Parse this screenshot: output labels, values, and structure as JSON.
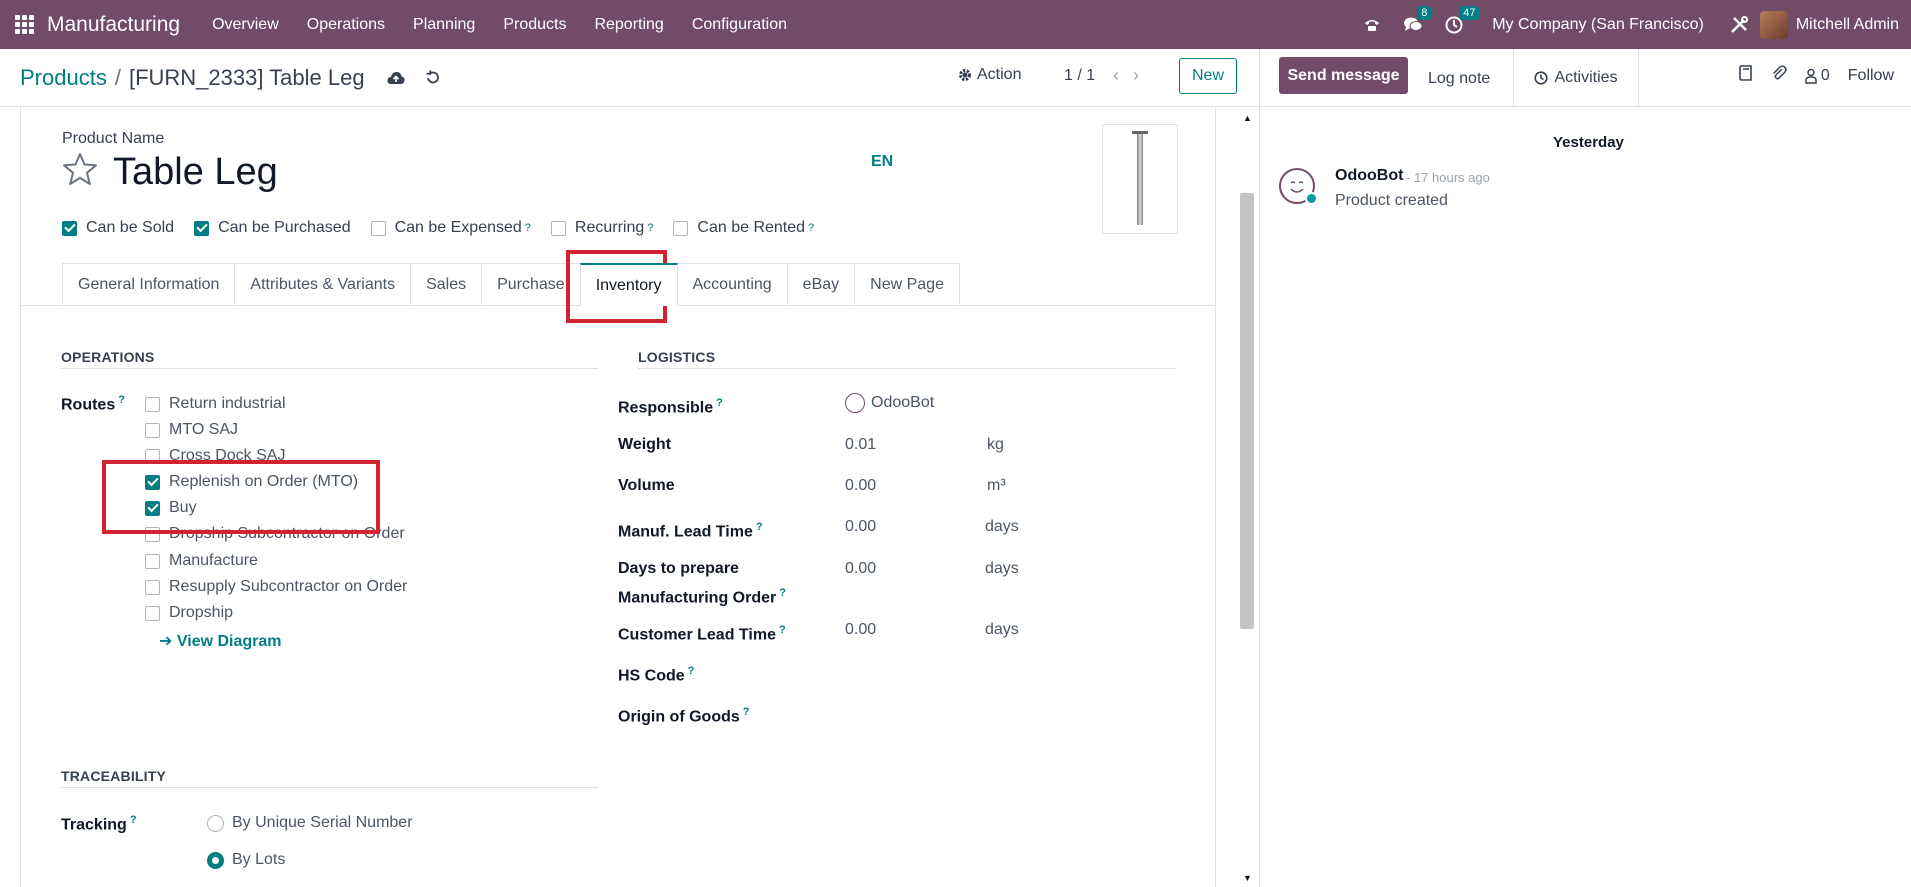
{
  "nav": {
    "app_name": "Manufacturing",
    "menu": [
      "Overview",
      "Operations",
      "Planning",
      "Products",
      "Reporting",
      "Configuration"
    ],
    "messages_badge": "8",
    "activities_badge": "47",
    "company": "My Company (San Francisco)",
    "user": "Mitchell Admin"
  },
  "control": {
    "breadcrumb_parent": "Products",
    "breadcrumb_current": "[FURN_2333] Table Leg",
    "action_label": "Action",
    "pager": "1 / 1",
    "new_label": "New"
  },
  "product": {
    "name_label": "Product Name",
    "name": "Table Leg",
    "lang": "EN",
    "flags": [
      {
        "label": "Can be Sold",
        "checked": true,
        "help": false
      },
      {
        "label": "Can be Purchased",
        "checked": true,
        "help": false
      },
      {
        "label": "Can be Expensed",
        "checked": false,
        "help": true
      },
      {
        "label": "Recurring",
        "checked": false,
        "help": true
      },
      {
        "label": "Can be Rented",
        "checked": false,
        "help": true
      }
    ]
  },
  "tabs": [
    "General Information",
    "Attributes & Variants",
    "Sales",
    "Purchase",
    "Inventory",
    "Accounting",
    "eBay",
    "New Page"
  ],
  "active_tab": "Inventory",
  "operations": {
    "title": "OPERATIONS",
    "routes_label": "Routes",
    "routes": [
      {
        "label": "Return industrial",
        "checked": false
      },
      {
        "label": "MTO SAJ",
        "checked": false
      },
      {
        "label": "Cross Dock SAJ",
        "checked": false
      },
      {
        "label": "Replenish on Order (MTO)",
        "checked": true
      },
      {
        "label": "Buy",
        "checked": true
      },
      {
        "label": "Dropship Subcontractor on Order",
        "checked": false
      },
      {
        "label": "Manufacture",
        "checked": false
      },
      {
        "label": "Resupply Subcontractor on Order",
        "checked": false
      },
      {
        "label": "Dropship",
        "checked": false
      }
    ],
    "view_diagram": "View Diagram"
  },
  "logistics": {
    "title": "LOGISTICS",
    "responsible_label": "Responsible",
    "responsible": "OdooBot",
    "weight_label": "Weight",
    "weight": "0.01",
    "weight_unit": "kg",
    "volume_label": "Volume",
    "volume": "0.00",
    "volume_unit": "m³",
    "manuf_lead_label": "Manuf. Lead Time",
    "manuf_lead": "0.00",
    "manuf_lead_unit": "days",
    "days_prepare_label_1": "Days to prepare",
    "days_prepare_label_2": "Manufacturing Order",
    "days_prepare": "0.00",
    "days_prepare_unit": "days",
    "customer_lead_label": "Customer Lead Time",
    "customer_lead": "0.00",
    "customer_lead_unit": "days",
    "hs_code_label": "HS Code",
    "origin_label": "Origin of Goods"
  },
  "traceability": {
    "title": "TRACEABILITY",
    "tracking_label": "Tracking",
    "options": [
      {
        "label": "By Unique Serial Number",
        "selected": false
      },
      {
        "label": "By Lots",
        "selected": true
      }
    ]
  },
  "chatter": {
    "send_message": "Send message",
    "log_note": "Log note",
    "activities": "Activities",
    "followers_count": "0",
    "follow": "Follow",
    "date_sep": "Yesterday",
    "message": {
      "author": "OdooBot",
      "time": "- 17 hours ago",
      "body": "Product created"
    }
  },
  "colors": {
    "brand": "#714B67",
    "accent": "#017E84",
    "highlight": "#d22330"
  }
}
